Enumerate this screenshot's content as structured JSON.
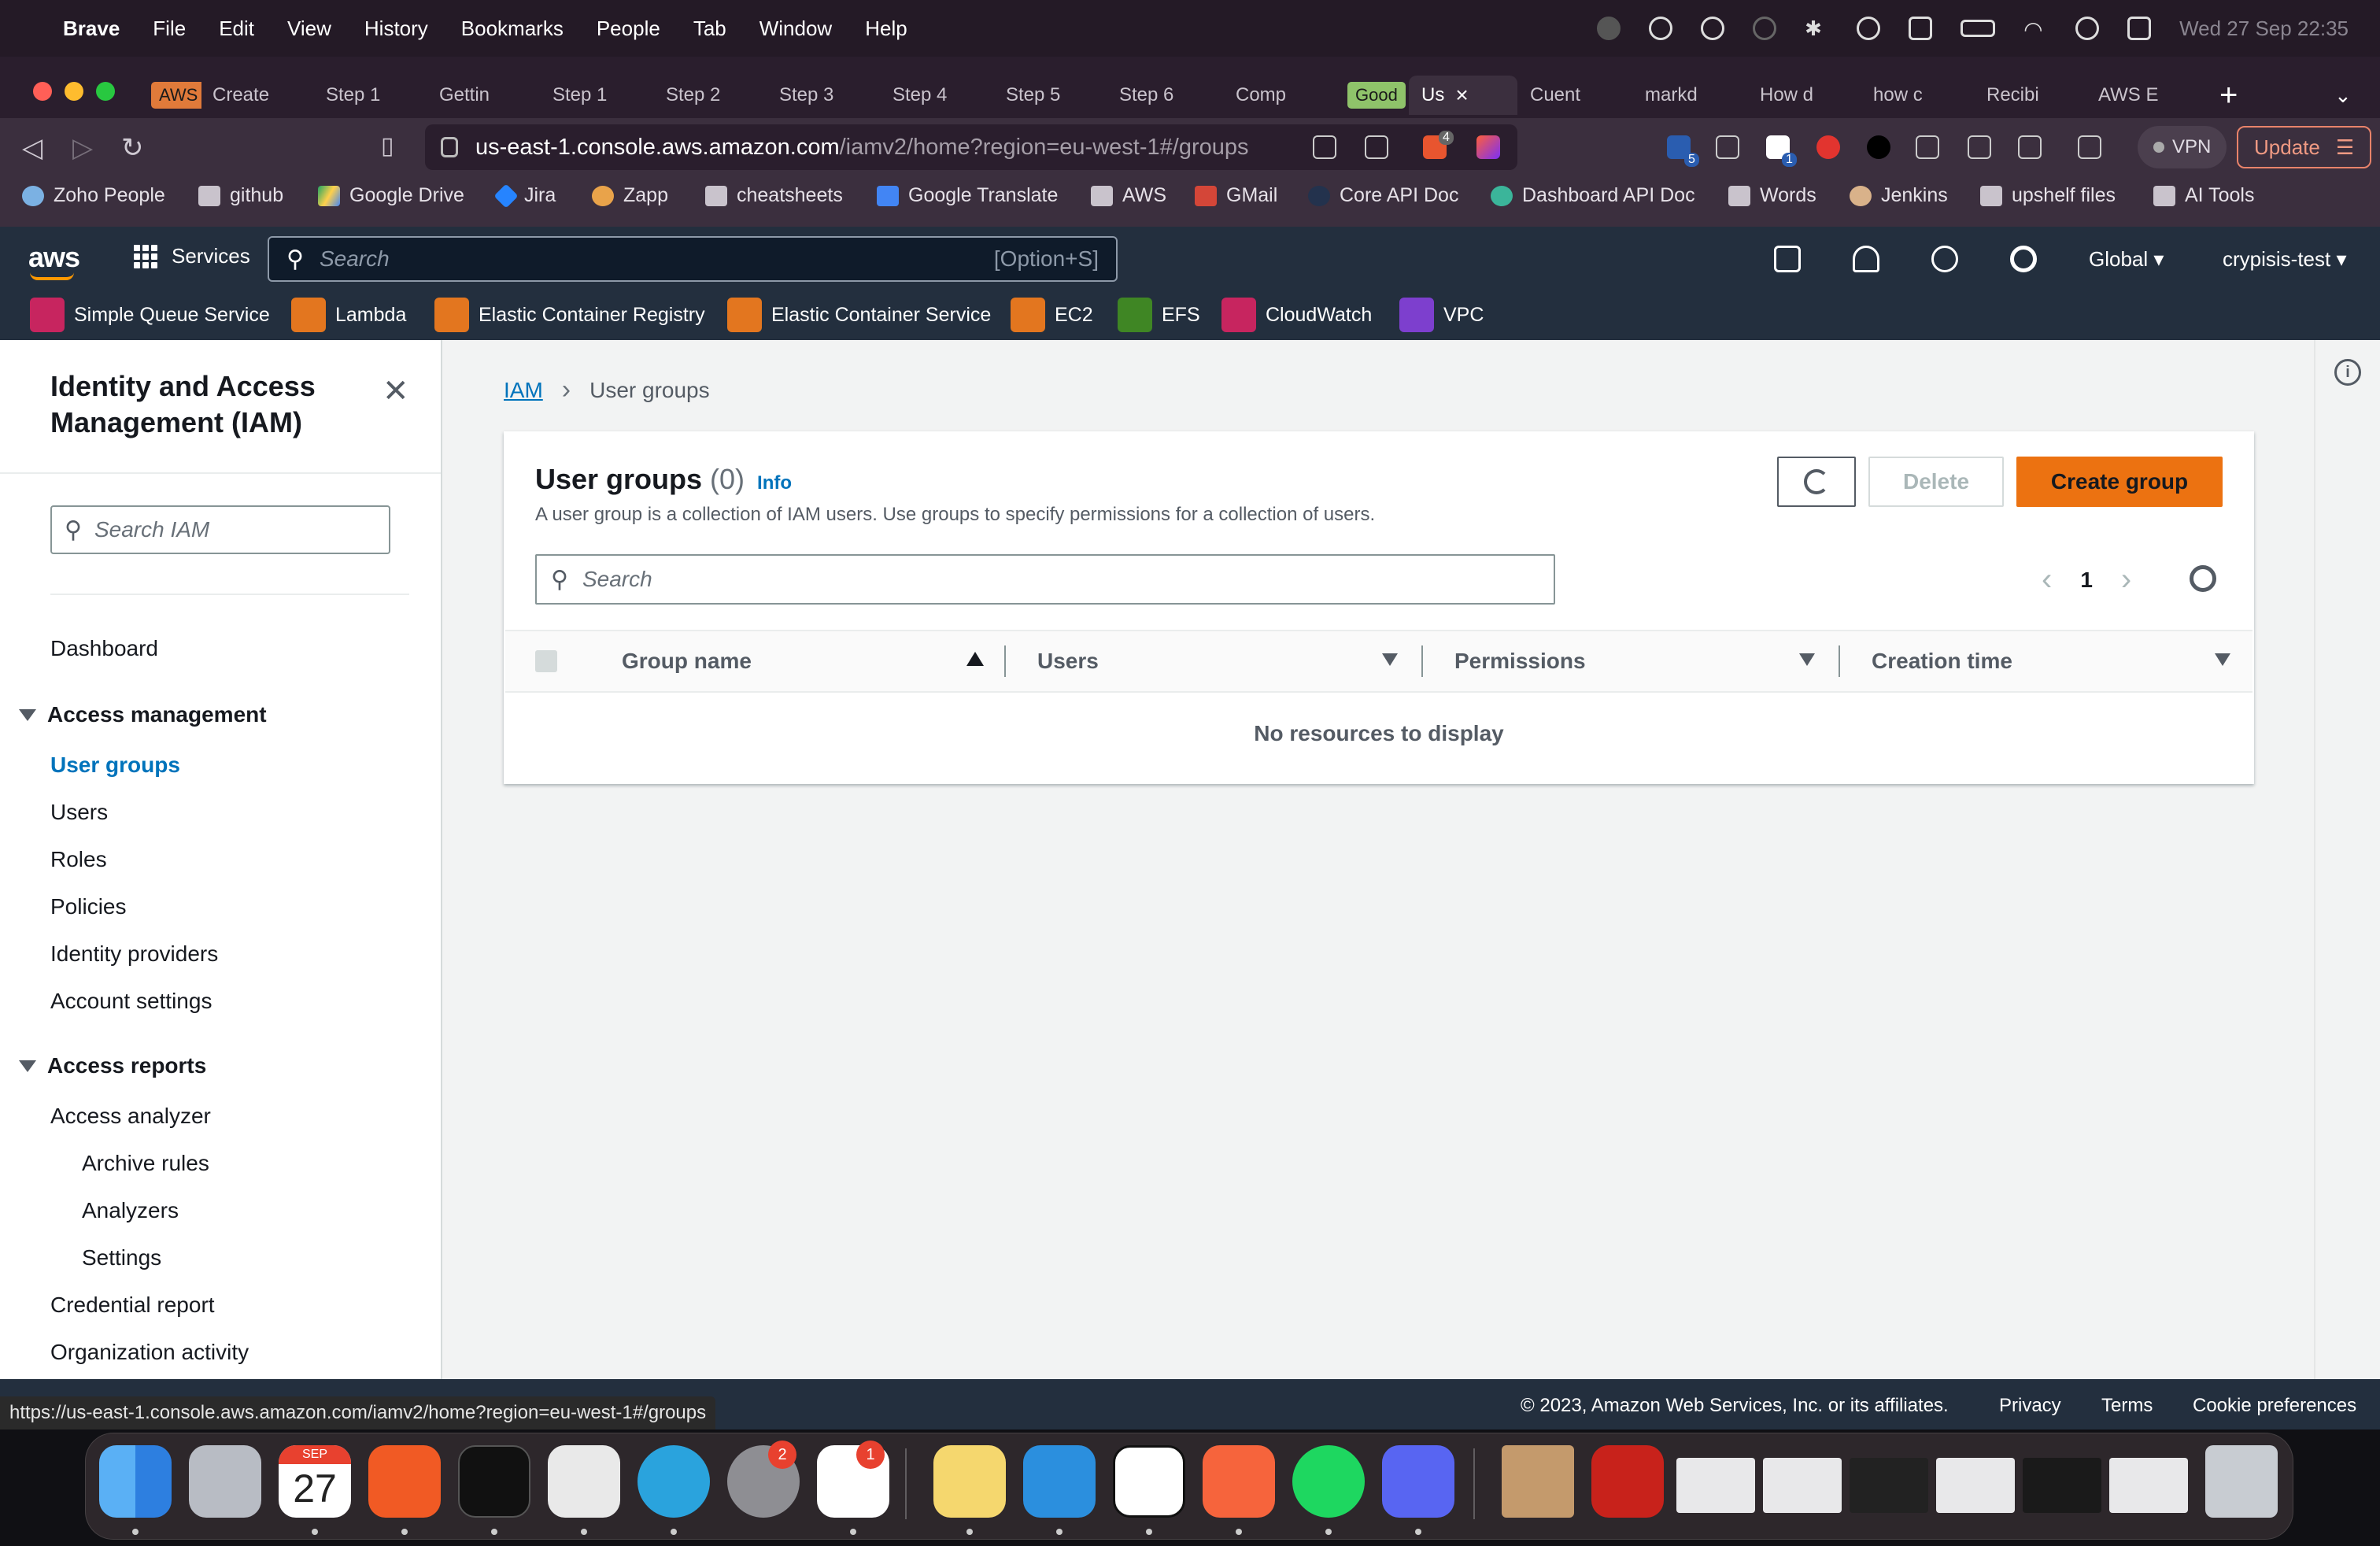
{
  "menubar": {
    "app": "Brave",
    "items": [
      "File",
      "Edit",
      "View",
      "History",
      "Bookmarks",
      "People",
      "Tab",
      "Window",
      "Help"
    ],
    "clock": "Wed 27 Sep  22:35"
  },
  "tabs": [
    {
      "label": "AWS"
    },
    {
      "label": "Create"
    },
    {
      "label": "Step 1"
    },
    {
      "label": "Gettin"
    },
    {
      "label": "Step 1"
    },
    {
      "label": "Step 2"
    },
    {
      "label": "Step 3"
    },
    {
      "label": "Step 4"
    },
    {
      "label": "Step 5"
    },
    {
      "label": "Step 6"
    },
    {
      "label": "Comp"
    },
    {
      "label": "Good"
    },
    {
      "label": "Us"
    },
    {
      "label": "Cuent"
    },
    {
      "label": "markd"
    },
    {
      "label": "How d"
    },
    {
      "label": "how c"
    },
    {
      "label": "Recibi"
    },
    {
      "label": "AWS E"
    }
  ],
  "address": {
    "host": "us-east-1.console.aws.amazon.com",
    "path": "/iamv2/home?region=eu-west-1#/groups",
    "shields_count": "4",
    "ext_badge_1": "5",
    "ext_badge_2": "1",
    "vpn": "VPN",
    "update": "Update"
  },
  "bookmarks": [
    "Zoho People",
    "github",
    "Google Drive",
    "Jira",
    "Zapp",
    "cheatsheets",
    "Google Translate",
    "AWS",
    "GMail",
    "Core API Doc",
    "Dashboard API Doc",
    "Words",
    "Jenkins",
    "upshelf files",
    "AI Tools"
  ],
  "aws": {
    "logo": "aws",
    "services": "Services",
    "search_placeholder": "Search",
    "search_shortcut": "[Option+S]",
    "region": "Global",
    "account": "crypisis-test",
    "favorites": [
      "Simple Queue Service",
      "Lambda",
      "Elastic Container Registry",
      "Elastic Container Service",
      "EC2",
      "EFS",
      "CloudWatch",
      "VPC"
    ]
  },
  "sidebar": {
    "title": "Identity and Access Management (IAM)",
    "search_placeholder": "Search IAM",
    "dashboard": "Dashboard",
    "access_management": "Access management",
    "am_items": [
      "User groups",
      "Users",
      "Roles",
      "Policies",
      "Identity providers",
      "Account settings"
    ],
    "access_reports": "Access reports",
    "ar_items": [
      "Access analyzer",
      "Archive rules",
      "Analyzers",
      "Settings",
      "Credential report",
      "Organization activity"
    ]
  },
  "breadcrumb": {
    "root": "IAM",
    "current": "User groups"
  },
  "panel": {
    "title": "User groups",
    "count": "(0)",
    "info": "Info",
    "description": "A user group is a collection of IAM users. Use groups to specify permissions for a collection of users.",
    "delete": "Delete",
    "create": "Create group",
    "search_placeholder": "Search",
    "page": "1",
    "columns": [
      "Group name",
      "Users",
      "Permissions",
      "Creation time"
    ],
    "empty": "No resources to display"
  },
  "footer": {
    "status_url": "https://us-east-1.console.aws.amazon.com/iamv2/home?region=eu-west-1#/groups",
    "copyright": "© 2023, Amazon Web Services, Inc. or its affiliates.",
    "privacy": "Privacy",
    "terms": "Terms",
    "cookies": "Cookie preferences"
  },
  "dock": {
    "calendar_month": "SEP",
    "calendar_day": "27",
    "badge_settings": "2",
    "badge_slack": "1"
  }
}
